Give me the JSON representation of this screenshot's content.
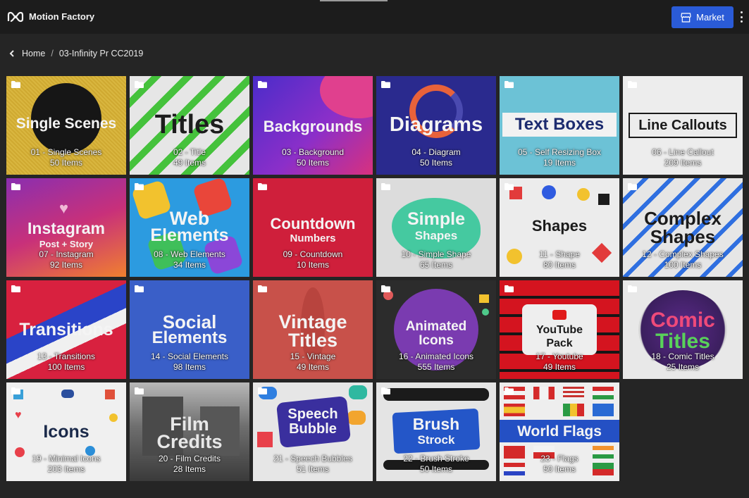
{
  "app": {
    "title": "Motion Factory",
    "logo_icon": "infinity-logo-icon"
  },
  "toolbar": {
    "market_label": "Market",
    "market_icon": "store-icon",
    "accent": "#2a5bd7",
    "more_icon": "kebab-menu-icon"
  },
  "breadcrumb": {
    "back_icon": "chevron-left-icon",
    "home": "Home",
    "separator": "/",
    "current": "03-Infinity Pr CC2019"
  },
  "folders": [
    {
      "art": "Single Scenes",
      "name": "01 - Single Scenes",
      "count": "50 Items"
    },
    {
      "art": "Titles",
      "name": "02 - Title",
      "count": "49 Items"
    },
    {
      "art": "Backgrounds",
      "name": "03 - Background",
      "count": "50 Items"
    },
    {
      "art": "Diagrams",
      "name": "04 - Diagram",
      "count": "50 Items"
    },
    {
      "art": "Text Boxes",
      "name": "05 - Self Resizing Box",
      "count": "19 Items"
    },
    {
      "art": "Line Callouts",
      "name": "06 - Line Callout",
      "count": "209 Items"
    },
    {
      "art": "Instagram",
      "art2": "Post + Story",
      "name": "07 - Instagram",
      "count": "92 Items"
    },
    {
      "art": "Web",
      "art2": "Elements",
      "name": "08 - Web Elements",
      "count": "34 Items"
    },
    {
      "art": "Countdown",
      "art2": "Numbers",
      "name": "09 - Countdown",
      "count": "10 Items"
    },
    {
      "art": "Simple",
      "art2": "Shapes",
      "name": "10 - Simple Shape",
      "count": "65 Items"
    },
    {
      "art": "Shapes",
      "name": "11 - Shape",
      "count": "80 Items"
    },
    {
      "art": "Complex",
      "art2": "Shapes",
      "name": "12 - Complex Shapes",
      "count": "100 Items"
    },
    {
      "art": "Transitions",
      "name": "13 - Transitions",
      "count": "100 Items"
    },
    {
      "art": "Social",
      "art2": "Elements",
      "name": "14 - Social Elements",
      "count": "98 Items"
    },
    {
      "art": "Vintage",
      "art2": "Titles",
      "name": "15 - Vintage",
      "count": "49 Items"
    },
    {
      "art": "Animated",
      "art2": "Icons",
      "name": "16 - Animated Icons",
      "count": "555 Items"
    },
    {
      "art": "YouTube",
      "art2": "Pack",
      "name": "17 - Youtube",
      "count": "49 Items"
    },
    {
      "art": "Comic",
      "art2": "Titles",
      "name": "18 - Comic Titles",
      "count": "25 Items"
    },
    {
      "art": "Icons",
      "name": "19 - Minimal Icons",
      "count": "203 Items"
    },
    {
      "art": "Film",
      "art2": "Credits",
      "name": "20 - Film Credits",
      "count": "28 Items"
    },
    {
      "art": "Speech",
      "art2": "Bubble",
      "name": "21 - Speech Bubbles",
      "count": "51 Items"
    },
    {
      "art": "Brush",
      "art2": "Strock",
      "name": "22 - Brush Stroke",
      "count": "50 Items"
    },
    {
      "art": "World Flags",
      "name": "23 - Flags",
      "count": "50 Items"
    }
  ]
}
